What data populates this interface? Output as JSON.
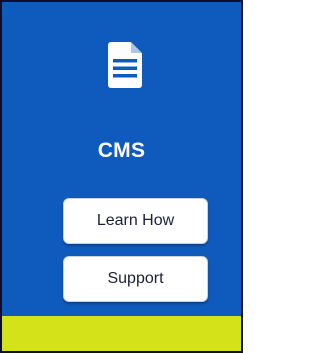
{
  "card": {
    "icon": "document-icon",
    "title": "CMS",
    "buttons": {
      "learn_how": "Learn How",
      "support": "Support"
    }
  },
  "colors": {
    "background": "#0f5bbd",
    "button_background": "#ffffff",
    "button_text": "#1b1f3a",
    "footer_accent": "#d4e21a"
  }
}
